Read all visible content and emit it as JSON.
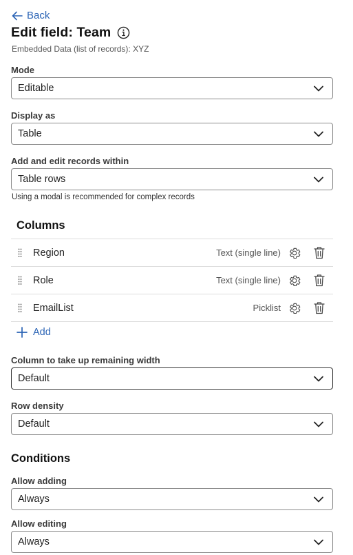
{
  "nav": {
    "back_label": "Back"
  },
  "header": {
    "title": "Edit field: Team",
    "subtitle": "Embedded Data (list of records): XYZ"
  },
  "fields": {
    "mode": {
      "label": "Mode",
      "value": "Editable"
    },
    "display_as": {
      "label": "Display as",
      "value": "Table"
    },
    "edit_within": {
      "label": "Add and edit records within",
      "value": "Table rows",
      "hint": "Using a modal is recommended for complex records"
    },
    "remaining_width": {
      "label": "Column to take up remaining width",
      "value": "Default"
    },
    "row_density": {
      "label": "Row density",
      "value": "Default"
    }
  },
  "columns": {
    "title": "Columns",
    "rows": [
      {
        "name": "Region",
        "type": "Text (single line)"
      },
      {
        "name": "Role",
        "type": "Text (single line)"
      },
      {
        "name": "EmailList",
        "type": "Picklist"
      }
    ],
    "add_label": "Add"
  },
  "conditions": {
    "title": "Conditions",
    "allow_adding": {
      "label": "Allow adding",
      "value": "Always"
    },
    "allow_editing": {
      "label": "Allow editing",
      "value": "Always"
    }
  },
  "colors": {
    "link": "#2b64b5",
    "border": "#8a8a8a",
    "divider": "#dcdcdc"
  }
}
